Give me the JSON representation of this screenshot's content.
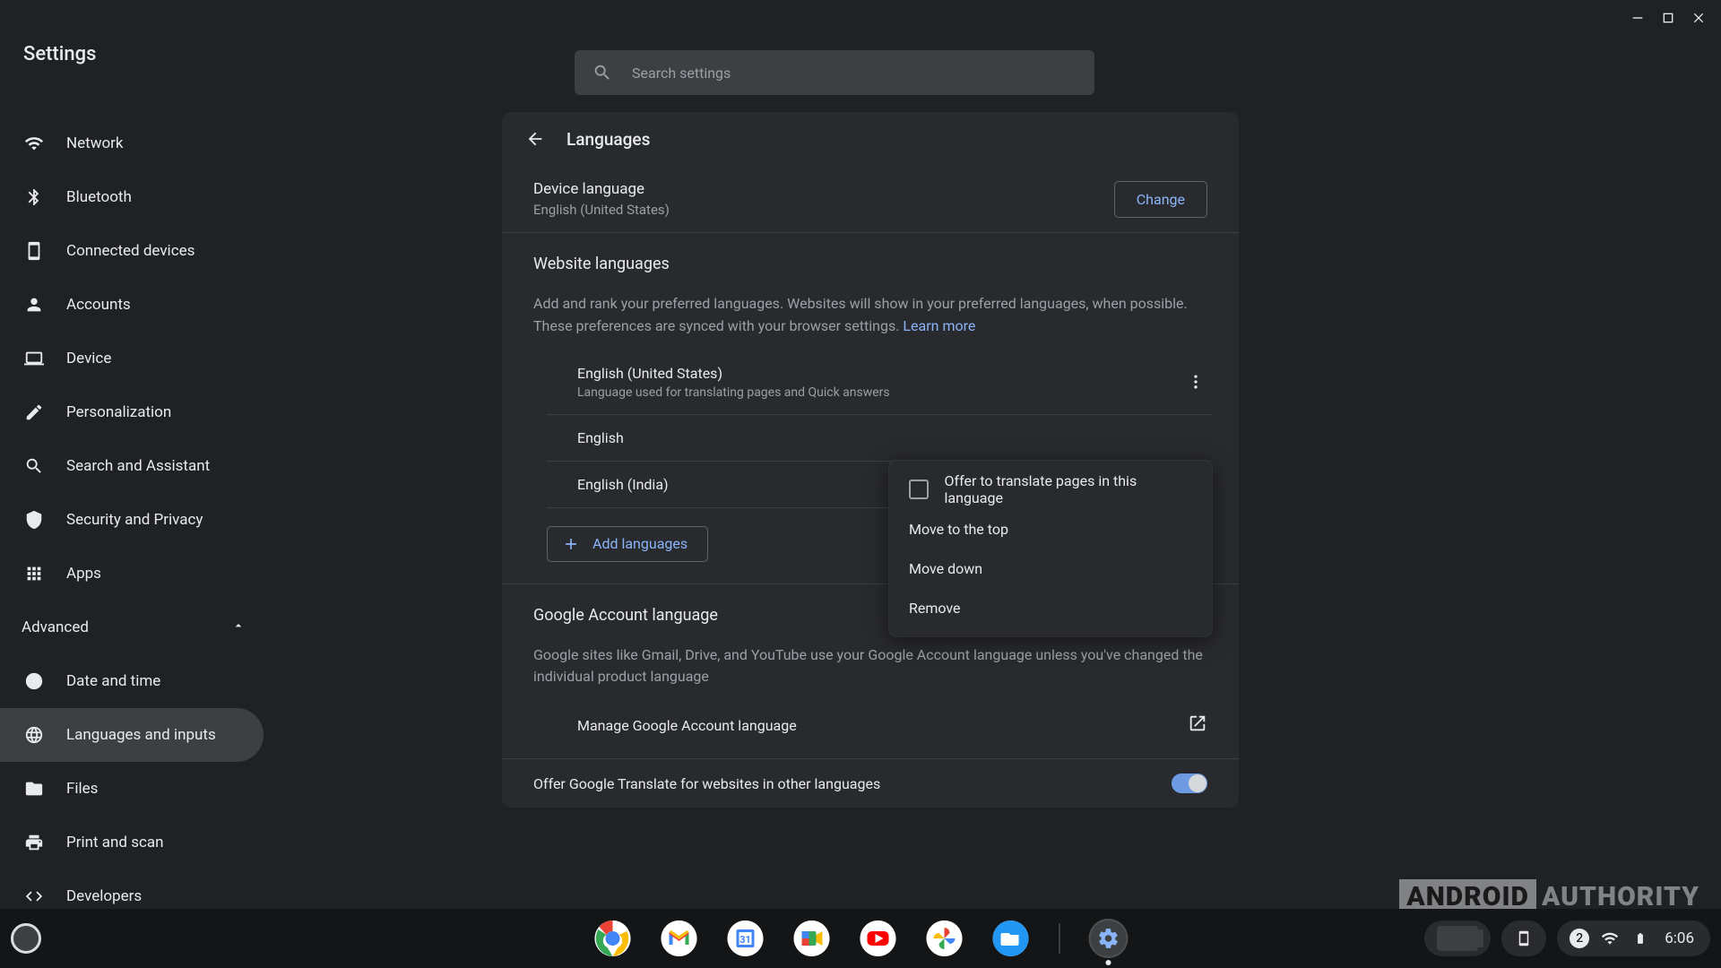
{
  "app": {
    "title": "Settings"
  },
  "search": {
    "placeholder": "Search settings"
  },
  "sidebar": {
    "items": [
      "Network",
      "Bluetooth",
      "Connected devices",
      "Accounts",
      "Device",
      "Personalization",
      "Search and Assistant",
      "Security and Privacy",
      "Apps"
    ],
    "advanced_label": "Advanced",
    "advanced_items": [
      "Date and time",
      "Languages and inputs",
      "Files",
      "Print and scan",
      "Developers"
    ],
    "active": "Languages and inputs"
  },
  "page": {
    "title": "Languages",
    "device_language": {
      "label": "Device language",
      "value": "English (United States)",
      "change_btn": "Change"
    },
    "website": {
      "title": "Website languages",
      "desc": "Add and rank your preferred languages. Websites will show in your preferred languages, when possible. These preferences are synced with your browser settings.",
      "learn_more": "Learn more",
      "langs": [
        {
          "name": "English (United States)",
          "note": "Language used for translating pages and Quick answers"
        },
        {
          "name": "English"
        },
        {
          "name": "English (India)"
        }
      ],
      "add_btn": "Add languages"
    },
    "acct": {
      "title": "Google Account language",
      "desc": "Google sites like Gmail, Drive, and YouTube use your Google Account language unless you've changed the individual product language",
      "manage": "Manage Google Account language"
    },
    "translate_toggle": {
      "label": "Offer Google Translate for websites in other languages",
      "on": true
    }
  },
  "context_menu": {
    "offer": "Offer to translate pages in this language",
    "top": "Move to the top",
    "down": "Move down",
    "remove": "Remove"
  },
  "watermark": {
    "a": "ANDROID",
    "b": "AUTHORITY"
  },
  "shelf": {
    "apps": [
      "Chrome",
      "Gmail",
      "Calendar",
      "Meet",
      "YouTube",
      "Photos",
      "Files",
      "Settings"
    ],
    "notif_count": "2",
    "clock": "6:06"
  }
}
